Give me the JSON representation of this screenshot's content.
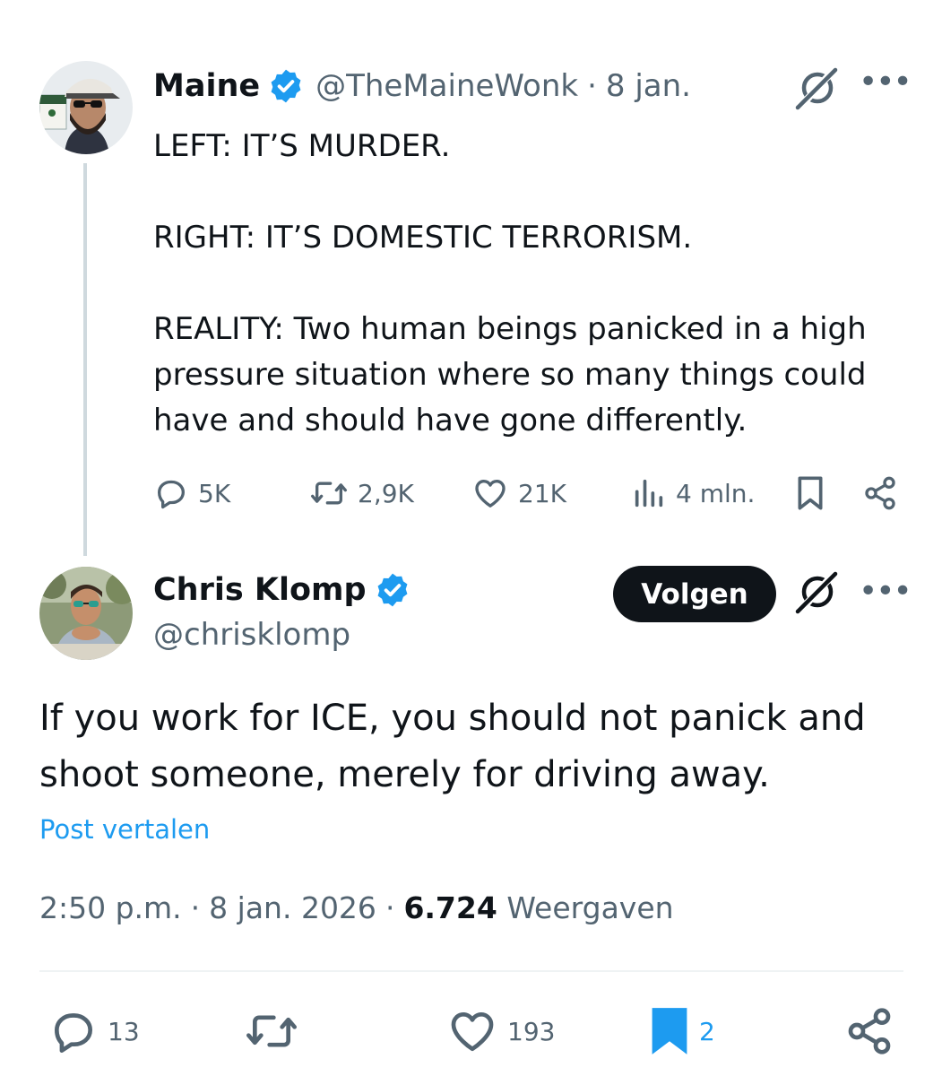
{
  "parent_tweet": {
    "display_name": "Maine",
    "handle": "@TheMaineWonk",
    "separator": "·",
    "date": "8 jan.",
    "paragraphs": [
      "LEFT: IT’S MURDER.",
      "RIGHT: IT’S DOMESTIC TERRORISM.",
      "REALITY: Two human beings panicked in a high pressure situation where so many things could have and should have gone differently."
    ],
    "stats": {
      "replies": "5K",
      "reposts": "2,9K",
      "likes": "21K",
      "views": "4 mln."
    }
  },
  "main_tweet": {
    "display_name": "Chris Klomp",
    "handle": "@chrisklomp",
    "follow_label": "Volgen",
    "text": "If you work for ICE, you should not panick and shoot someone, merely for driving away.",
    "translate_label": "Post vertalen",
    "time": "2:50 p.m.",
    "separator": "·",
    "date": "8 jan. 2026",
    "views_count": "6.724",
    "views_label": "Weergaven",
    "stats": {
      "replies": "13",
      "likes": "193",
      "bookmarks": "2"
    }
  },
  "icons": {
    "verified": "verified-badge-icon",
    "grok": "grok-icon",
    "more": "more-icon",
    "reply": "reply-icon",
    "repost": "repost-icon",
    "like": "like-icon",
    "views": "views-icon",
    "bookmark": "bookmark-icon",
    "share": "share-icon"
  },
  "colors": {
    "text": "#0f1419",
    "secondary": "#536471",
    "link": "#1d9bf0",
    "verified": "#1d9bf0",
    "bookmark_active": "#1d9bf0",
    "follow_bg": "#0f1419",
    "thread_line": "#cfd9de"
  }
}
